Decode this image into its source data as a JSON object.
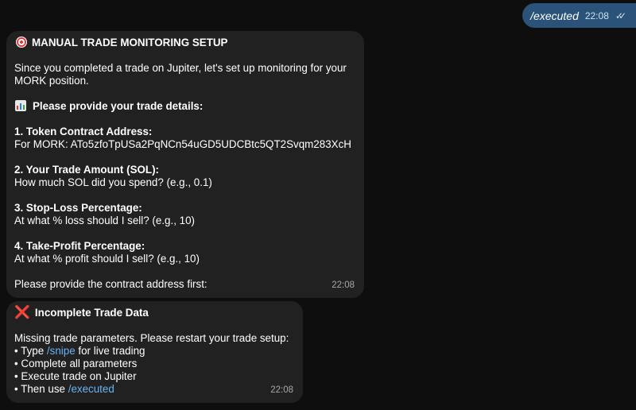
{
  "outgoing": {
    "text": "/executed",
    "time": "22:08",
    "ticks": "✓✓"
  },
  "message1": {
    "title": "MANUAL TRADE MONITORING SETUP",
    "intro_line1": "Since you completed a trade on Jupiter, let's set up monitoring for your",
    "intro_line2": "MORK position.",
    "details_heading": "Please provide your trade details:",
    "item1_title": "1. Token Contract Address:",
    "item1_text": "For MORK: ATo5zfoTpUSa2PqNCn54uGD5UDCBtc5QT2Svqm283XcH",
    "item2_title": "2. Your Trade Amount (SOL):",
    "item2_text": "How much SOL did you spend? (e.g., 0.1)",
    "item3_title": "3. Stop-Loss Percentage:",
    "item3_text": "At what % loss should I sell? (e.g., 10)",
    "item4_title": "4. Take-Profit Percentage:",
    "item4_text": "At what % profit should I sell? (e.g., 10)",
    "closing": "Please provide the contract address first:",
    "time": "22:08"
  },
  "message2": {
    "icon": "❌",
    "title": "Incomplete Trade Data",
    "body": "Missing trade parameters. Please restart your trade setup:",
    "bullet1_prefix": "• Type ",
    "bullet1_link": "/snipe",
    "bullet1_suffix": " for live trading",
    "bullet2": "• Complete all parameters",
    "bullet3": "• Execute trade on Jupiter",
    "bullet4_prefix": "• Then use ",
    "bullet4_link": "/executed",
    "time": "22:08"
  },
  "colors": {
    "background": "#0e0e0e",
    "incoming_bubble": "#212121",
    "outgoing_bubble": "#2b5278",
    "link": "#6ab3f3"
  },
  "icons": [
    "target-icon",
    "bar-chart-icon",
    "cross-mark-icon",
    "double-check-icon"
  ]
}
